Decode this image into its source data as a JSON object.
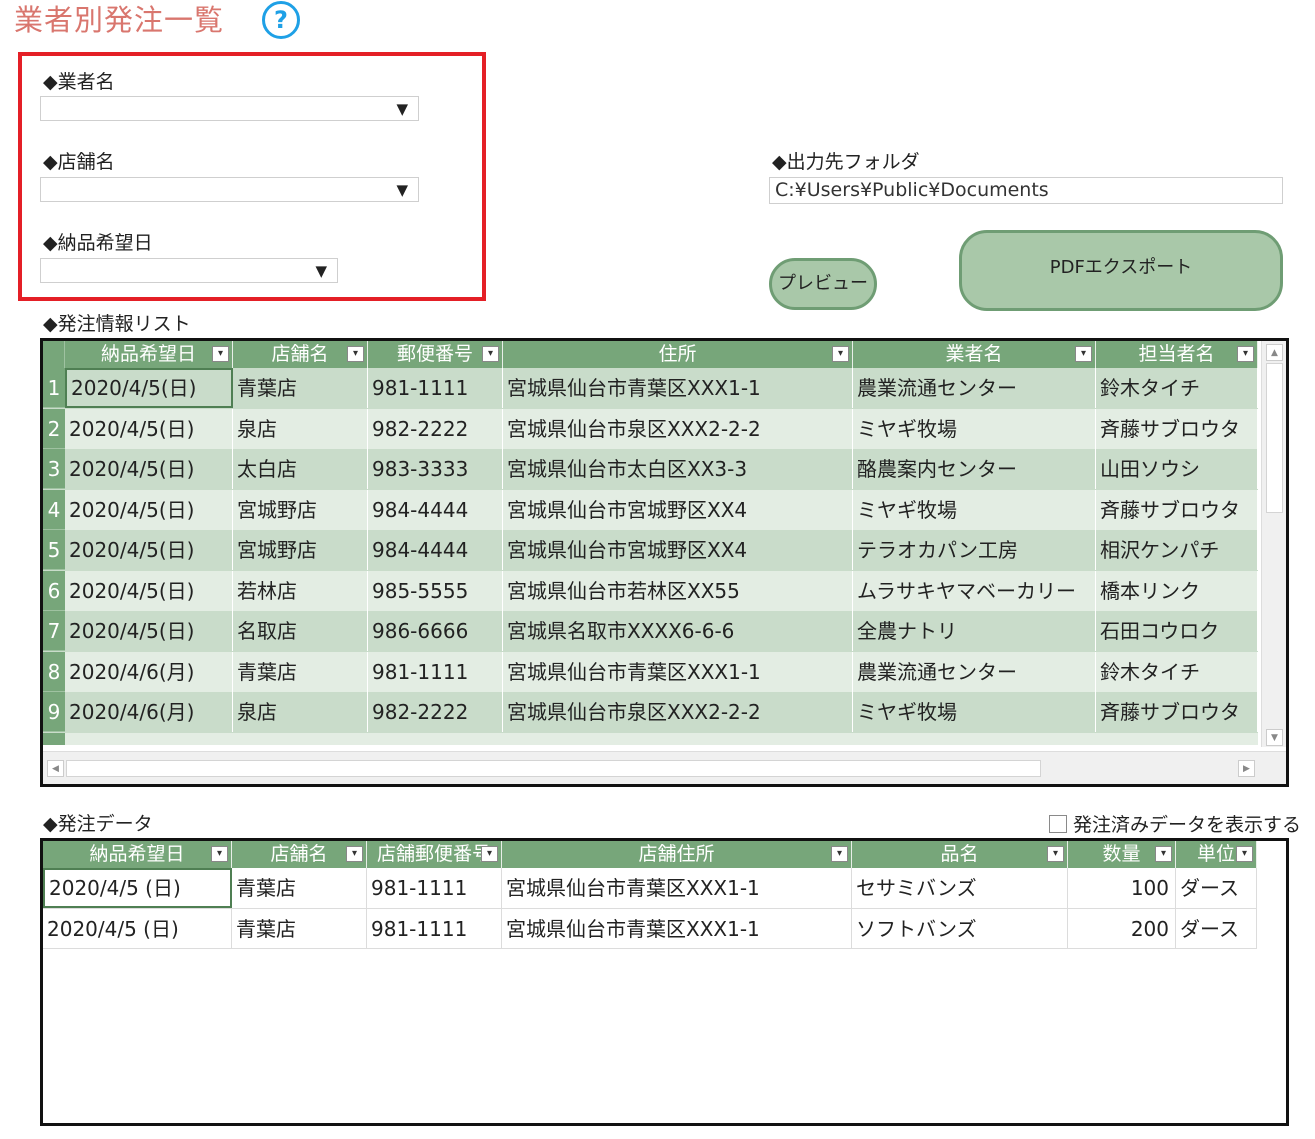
{
  "header": {
    "title": "業者別発注一覧",
    "help_icon": "?"
  },
  "filters": {
    "vendor_label": "◆業者名",
    "store_label": "◆店舗名",
    "delivery_date_label": "◆納品希望日",
    "dropdown_arrow": "▼"
  },
  "output": {
    "folder_label": "◆出力先フォルダ",
    "folder_value": "C:¥Users¥Public¥Documents"
  },
  "buttons": {
    "preview": "プレビュー",
    "pdf_export": "PDFエクスポート"
  },
  "order_list": {
    "label": "◆発注情報リスト",
    "columns": [
      "納品希望日",
      "店舗名",
      "郵便番号",
      "住所",
      "業者名",
      "担当者名"
    ],
    "rows": [
      [
        "1",
        "2020/4/5(日)",
        "青葉店",
        "981-1111",
        "宮城県仙台市青葉区XXX1-1",
        "農業流通センター",
        "鈴木タイチ"
      ],
      [
        "2",
        "2020/4/5(日)",
        "泉店",
        "982-2222",
        "宮城県仙台市泉区XXX2-2-2",
        "ミヤギ牧場",
        "斉藤サブロウタ"
      ],
      [
        "3",
        "2020/4/5(日)",
        "太白店",
        "983-3333",
        "宮城県仙台市太白区XX3-3",
        "酪農案内センター",
        "山田ソウシ"
      ],
      [
        "4",
        "2020/4/5(日)",
        "宮城野店",
        "984-4444",
        "宮城県仙台市宮城野区XX4",
        "ミヤギ牧場",
        "斉藤サブロウタ"
      ],
      [
        "5",
        "2020/4/5(日)",
        "宮城野店",
        "984-4444",
        "宮城県仙台市宮城野区XX4",
        "テラオカパン工房",
        "相沢ケンパチ"
      ],
      [
        "6",
        "2020/4/5(日)",
        "若林店",
        "985-5555",
        "宮城県仙台市若林区XX55",
        "ムラサキヤマベーカリー",
        "橋本リンク"
      ],
      [
        "7",
        "2020/4/5(日)",
        "名取店",
        "986-6666",
        "宮城県名取市XXXX6-6-6",
        "全農ナトリ",
        "石田コウロク"
      ],
      [
        "8",
        "2020/4/6(月)",
        "青葉店",
        "981-1111",
        "宮城県仙台市青葉区XXX1-1",
        "農業流通センター",
        "鈴木タイチ"
      ],
      [
        "9",
        "2020/4/6(月)",
        "泉店",
        "982-2222",
        "宮城県仙台市泉区XXX2-2-2",
        "ミヤギ牧場",
        "斉藤サブロウタ"
      ]
    ]
  },
  "order_data": {
    "label": "◆発注データ",
    "show_ordered_label": "発注済みデータを表示する",
    "columns": [
      "納品希望日",
      "店舗名",
      "店舗郵便番号",
      "店舗住所",
      "品名",
      "数量",
      "単位"
    ],
    "rows": [
      [
        "2020/4/5 (日)",
        "青葉店",
        "981-1111",
        "宮城県仙台市青葉区XXX1-1",
        "セサミバンズ",
        "100",
        "ダース"
      ],
      [
        "2020/4/5 (日)",
        "青葉店",
        "981-1111",
        "宮城県仙台市青葉区XXX1-1",
        "ソフトバンズ",
        "200",
        "ダース"
      ]
    ]
  },
  "colors": {
    "title": "#d9766e",
    "header_green": "#77a67a",
    "row_dark": "#c9dcca",
    "row_light": "#e3ede3",
    "filter_border": "#e41f26",
    "button_fill": "#a9c8a9"
  }
}
